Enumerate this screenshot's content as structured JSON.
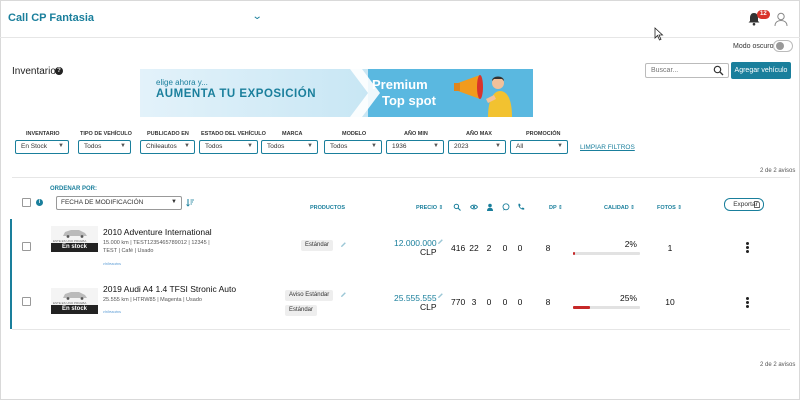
{
  "header": {
    "app_title": "Call CP Fantasia",
    "notifications_count": "12"
  },
  "dark_mode": {
    "label": "Modo oscuro",
    "enabled": false
  },
  "inventory": {
    "title": "Inventario"
  },
  "banner": {
    "small_text": "elige ahora y...",
    "big_text": "AUMENTA TU EXPOSICIÓN",
    "premium_line1": "Premium",
    "premium_line2": "Top spot"
  },
  "search": {
    "placeholder": "Buscar..."
  },
  "add_vehicle_label": "Agregar vehículo",
  "filters": [
    {
      "label": "INVENTARIO",
      "value": "En Stock"
    },
    {
      "label": "TIPO DE VEHÍCULO",
      "value": "Todos"
    },
    {
      "label": "PUBLICADO EN",
      "value": "Chileautos"
    },
    {
      "label": "ESTADO DEL VEHÍCULO",
      "value": "Todos"
    },
    {
      "label": "MARCA",
      "value": "Todos"
    },
    {
      "label": "MODELO",
      "value": "Todos"
    },
    {
      "label": "AÑO MIN",
      "value": "1936"
    },
    {
      "label": "AÑO MAX",
      "value": "2023"
    },
    {
      "label": "PROMOCIÓN",
      "value": "All"
    }
  ],
  "clear_filters_label": "LIMPIAR FILTROS",
  "result_count": "2 de 2 avisos",
  "sort": {
    "label": "ORDENAR POR:",
    "value": "FECHA DE MODIFICACIÓN"
  },
  "columns": {
    "products": "PRODUCTOS",
    "price": "PRECIO",
    "dp": "DP",
    "quality": "CALIDAD",
    "photos": "FOTOS"
  },
  "stat_icons": [
    "search-icon",
    "eye-icon",
    "person-icon",
    "whatsapp-icon",
    "phone-icon"
  ],
  "export_label": "Exportar",
  "rows": [
    {
      "stock_badge": "En stock",
      "thumb_text": "ESTE ES UNO PRUEBA",
      "brand": "chileautos",
      "title": "2010 Adventure International",
      "meta1": "15.000 km | TEST1235465789012 | 12345 |",
      "meta2": "TEST | Café | Usado",
      "products": [
        "Estándar"
      ],
      "price": "12.000.000",
      "currency": "CLP",
      "stats": [
        "416",
        "22",
        "2",
        "0",
        "0"
      ],
      "dp": "8",
      "quality": "2%",
      "quality_value": 0.02,
      "photos": "1"
    },
    {
      "stock_badge": "En stock",
      "thumb_text": "ESTE ES UNO PRUEBA",
      "brand": "chileautos",
      "title": "2019 Audi A4 1.4 TFSI Stronic Auto",
      "meta1": "25.555 km | HTRW85 | Magenta | Usado",
      "meta2": "",
      "products": [
        "Aviso Estándar",
        "Estándar"
      ],
      "price": "25.555.555",
      "currency": "CLP",
      "stats": [
        "770",
        "3",
        "0",
        "0",
        "0"
      ],
      "dp": "8",
      "quality": "25%",
      "quality_value": 0.25,
      "photos": "10"
    }
  ],
  "colors": {
    "accent": "#1a7f9c",
    "danger": "#c62828",
    "badge": "#d9342b"
  }
}
